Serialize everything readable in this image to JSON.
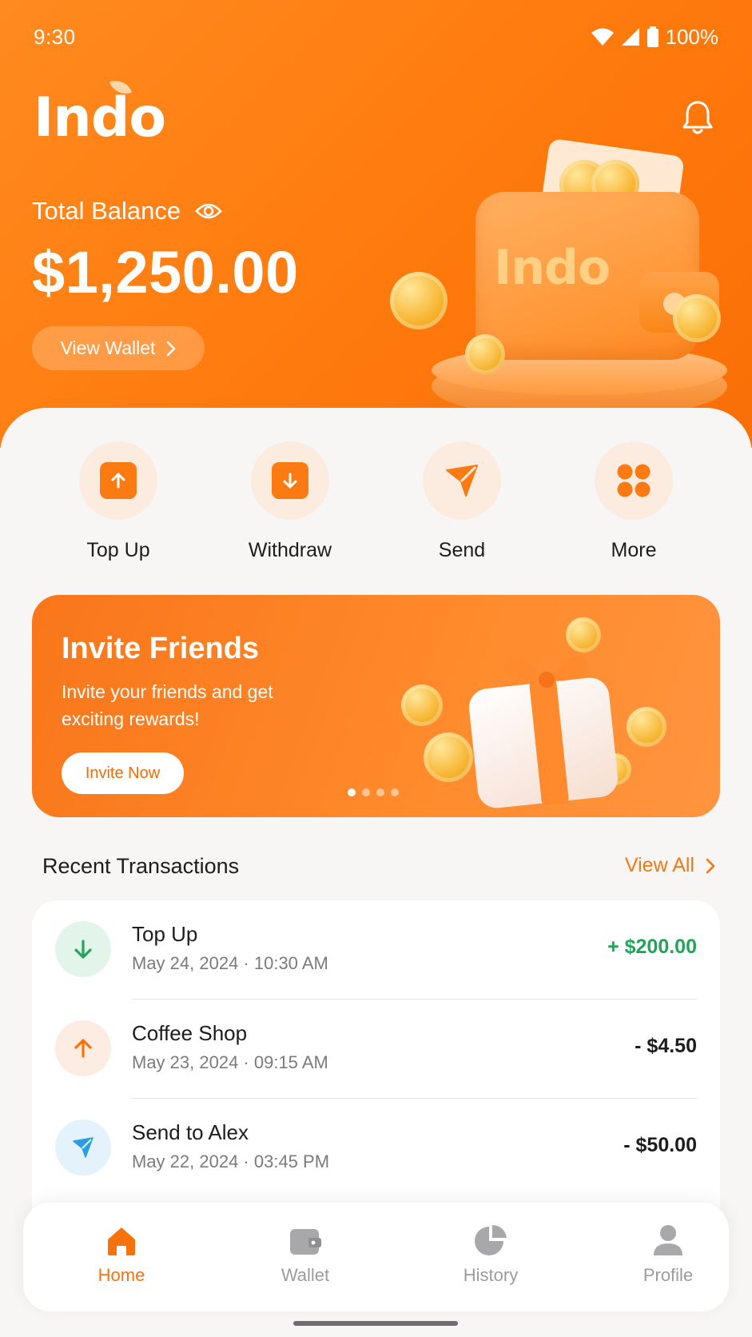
{
  "status_bar": {
    "time": "9:30",
    "battery": "100%"
  },
  "header": {
    "logo": "Indo",
    "balance_label": "Total Balance",
    "balance_value": "$1,250.00",
    "view_wallet": "View Wallet"
  },
  "quick_actions": [
    {
      "label": "Top Up",
      "icon": "arrow-up-icon"
    },
    {
      "label": "Withdraw",
      "icon": "arrow-down-icon"
    },
    {
      "label": "Send",
      "icon": "send-icon"
    },
    {
      "label": "More",
      "icon": "grid-icon"
    }
  ],
  "promo": {
    "title": "Invite Friends",
    "text": "Invite your friends and get exciting rewards!",
    "button": "Invite Now",
    "slides": 4,
    "active_slide": 1
  },
  "transactions": {
    "title": "Recent Transactions",
    "view_all": "View All",
    "items": [
      {
        "name": "Top Up",
        "date": "May 24, 2024 · 10:30 AM",
        "amount": "+ $200.00",
        "type": "credit",
        "icon": "arrow-down-icon"
      },
      {
        "name": "Coffee Shop",
        "date": "May 23, 2024 · 09:15 AM",
        "amount": "- $4.50",
        "type": "debit",
        "icon": "arrow-up-icon"
      },
      {
        "name": "Send to Alex",
        "date": "May 22, 2024 · 03:45 PM",
        "amount": "- $50.00",
        "type": "debit",
        "icon": "send-icon"
      }
    ]
  },
  "nav": {
    "items": [
      {
        "label": "Home",
        "active": true
      },
      {
        "label": "Wallet",
        "active": false
      },
      {
        "label": "History",
        "active": false
      },
      {
        "label": "Profile",
        "active": false
      }
    ]
  },
  "colors": {
    "accent": "#f8720c",
    "positive": "#22a55b",
    "background": "#f8f6f4"
  }
}
